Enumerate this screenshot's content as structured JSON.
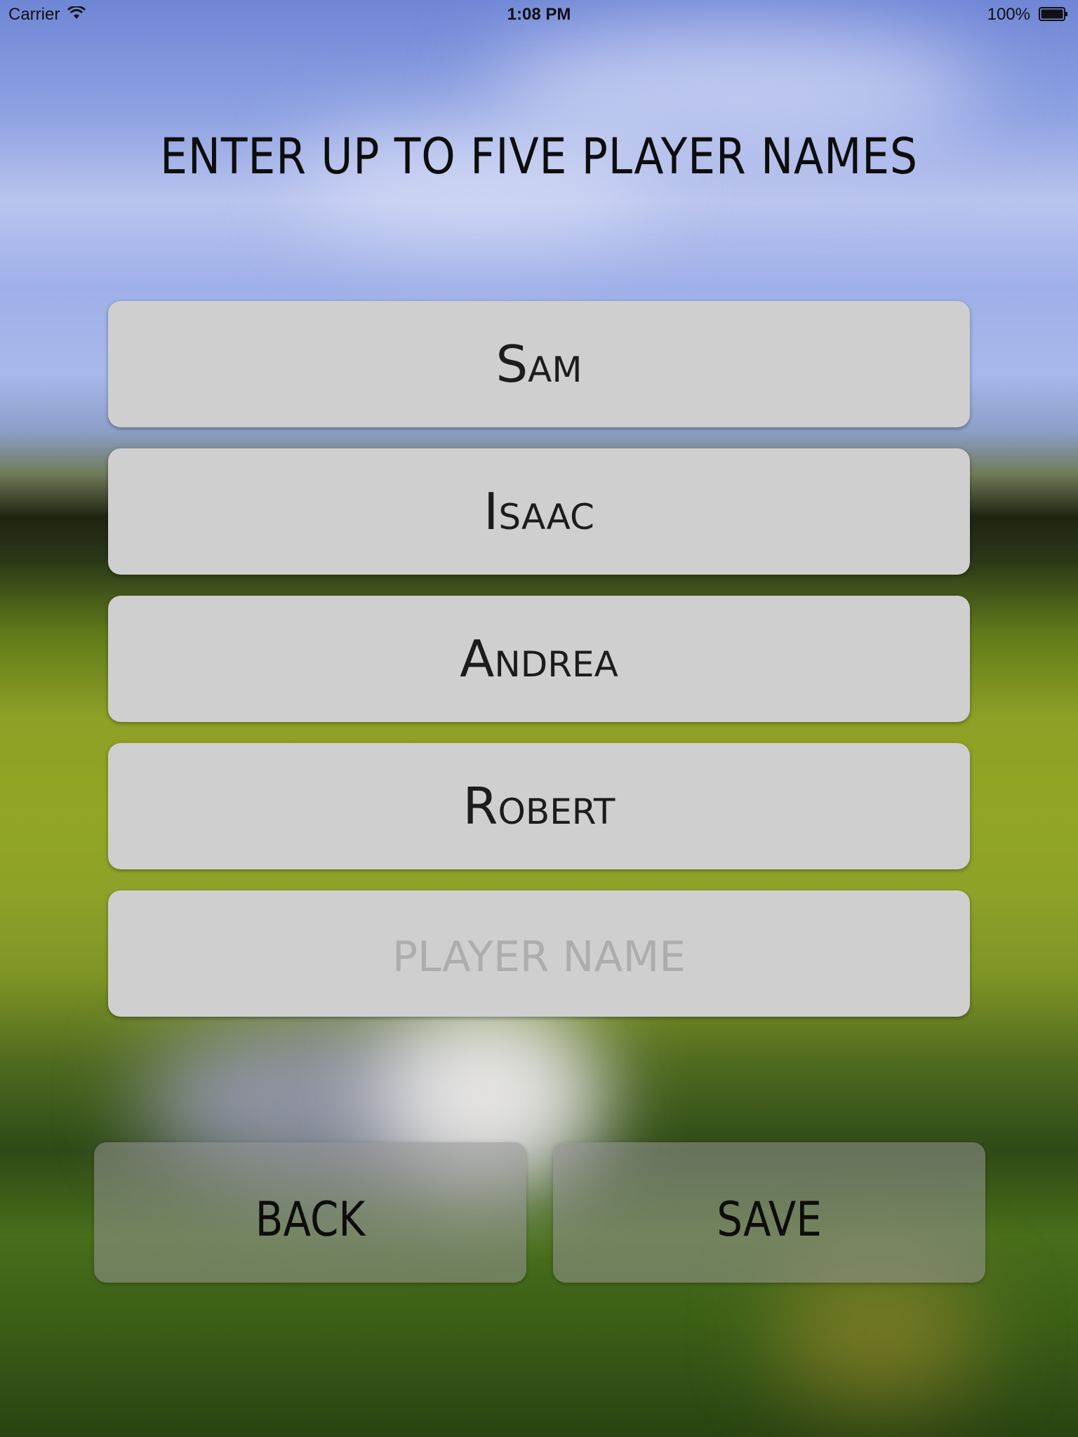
{
  "status_bar": {
    "carrier": "Carrier",
    "time": "1:08 PM",
    "battery_percent": "100%",
    "wifi_icon": "wifi-icon",
    "battery_icon": "battery-icon"
  },
  "title": "ENTER UP TO FIVE PLAYER NAMES",
  "players": [
    {
      "value": "Sam",
      "placeholder": "PLAYER NAME"
    },
    {
      "value": "Isaac",
      "placeholder": "PLAYER NAME"
    },
    {
      "value": "Andrea",
      "placeholder": "PLAYER NAME"
    },
    {
      "value": "Robert",
      "placeholder": "PLAYER NAME"
    },
    {
      "value": "",
      "placeholder": "PLAYER NAME"
    }
  ],
  "buttons": {
    "back_label": "BACK",
    "save_label": "SAVE"
  },
  "colors": {
    "field_background": "#cfcfcf",
    "text": "#1c1c1c",
    "placeholder": "#adadad"
  }
}
